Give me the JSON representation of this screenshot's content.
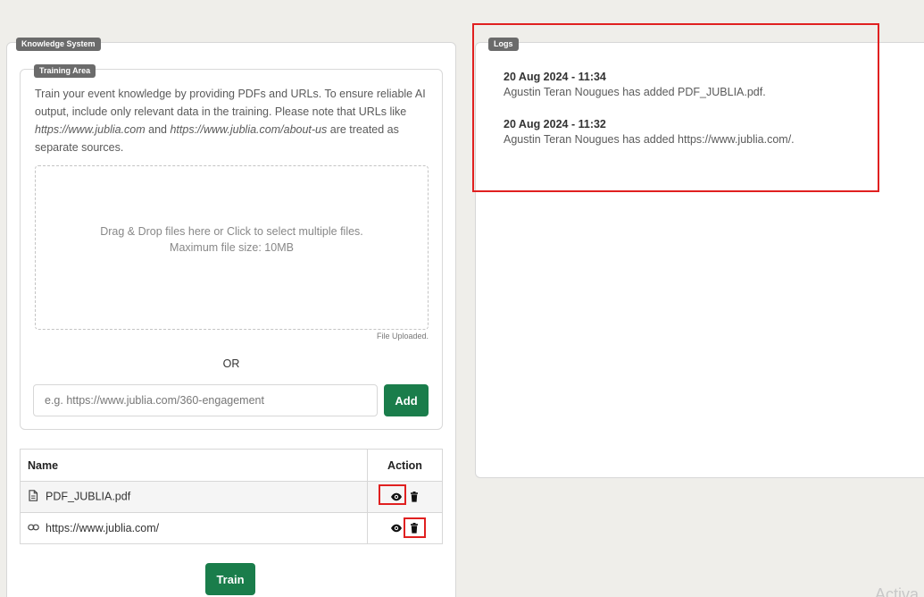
{
  "knowledge_system": {
    "badge": "Knowledge System",
    "training_area": {
      "badge": "Training Area",
      "description_1": "Train your event knowledge by providing PDFs and URLs. To ensure reliable AI output, include only relevant data in the training. Please note that URLs like ",
      "url_example_1": "https://www.jublia.com",
      "description_2": " and ",
      "url_example_2": "https://www.jublia.com/about-us",
      "description_3": " are treated as separate sources.",
      "dropzone_line1": "Drag & Drop files here or Click to select multiple files.",
      "dropzone_line2": "Maximum file size: 10MB",
      "file_uploaded": "File Uploaded.",
      "or_label": "OR",
      "url_placeholder": "e.g. https://www.jublia.com/360-engagement",
      "add_label": "Add"
    },
    "table": {
      "headers": {
        "name": "Name",
        "action": "Action"
      },
      "rows": [
        {
          "icon": "document-icon",
          "name": "PDF_JUBLIA.pdf"
        },
        {
          "icon": "link-icon",
          "name": "https://www.jublia.com/"
        }
      ]
    },
    "train_label": "Train"
  },
  "logs": {
    "badge": "Logs",
    "entries": [
      {
        "time": "20 Aug 2024 - 11:34",
        "message": "Agustin Teran Nougues has added PDF_JUBLIA.pdf."
      },
      {
        "time": "20 Aug 2024 - 11:32",
        "message": "Agustin Teran Nougues has added https://www.jublia.com/."
      }
    ]
  },
  "watermark": "Activa",
  "colors": {
    "primary_green": "#1a7d4b",
    "badge_gray": "#6b6b6b",
    "highlight_red": "#e02020"
  }
}
